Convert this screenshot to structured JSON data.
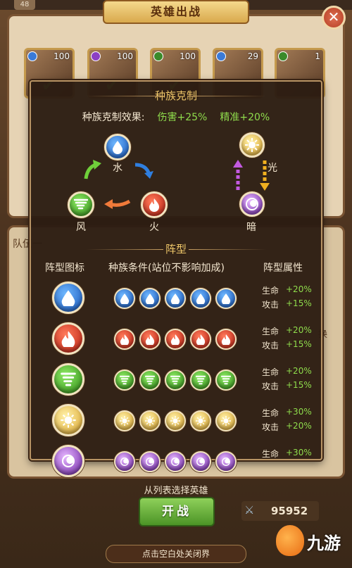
{
  "status_bar": {
    "level": "48"
  },
  "title": "英雄出战",
  "hero_cards": [
    {
      "level": "100",
      "race_color": "#3a7ad8",
      "checked": true
    },
    {
      "level": "100",
      "race_color": "#8b3fc4",
      "checked": true
    },
    {
      "level": "100",
      "race_color": "#3a8a2a",
      "checked": true
    },
    {
      "level": "29",
      "race_color": "#3a7ad8",
      "checked": false
    },
    {
      "level": "1",
      "race_color": "#3a8a2a",
      "checked": false
    }
  ],
  "team": {
    "label": "队伍一",
    "swap": "换"
  },
  "popup": {
    "race_section": {
      "title": "种族克制",
      "effect_label": "种族克制效果:",
      "effect_damage": "伤害+25%",
      "effect_accuracy": "精准+20%",
      "races": {
        "water": "水",
        "fire": "火",
        "wind": "风",
        "light": "光",
        "dark": "暗"
      }
    },
    "formation_section": {
      "title": "阵型",
      "col_icon": "阵型图标",
      "col_condition": "种族条件(站位不影响加成)",
      "col_attr": "阵型属性",
      "rows": [
        {
          "race": "water",
          "hp_label": "生命",
          "hp": "+20%",
          "atk_label": "攻击",
          "atk": "+15%"
        },
        {
          "race": "fire",
          "hp_label": "生命",
          "hp": "+20%",
          "atk_label": "攻击",
          "atk": "+15%"
        },
        {
          "race": "wind",
          "hp_label": "生命",
          "hp": "+20%",
          "atk_label": "攻击",
          "atk": "+15%"
        },
        {
          "race": "light",
          "hp_label": "生命",
          "hp": "+30%",
          "atk_label": "攻击",
          "atk": "+20%"
        },
        {
          "race": "dark",
          "hp_label": "生命",
          "hp": "+30%"
        }
      ]
    }
  },
  "footer": {
    "pick_hint": "从列表选择英雄",
    "start_button": "开战",
    "power": "95952",
    "close_hint": "点击空白处关闭界",
    "brand": "九游"
  },
  "colors": {
    "accent_gold": "#f0c86a",
    "bonus_green": "#8fdc4c",
    "popup_bg": "#2c1c12"
  }
}
